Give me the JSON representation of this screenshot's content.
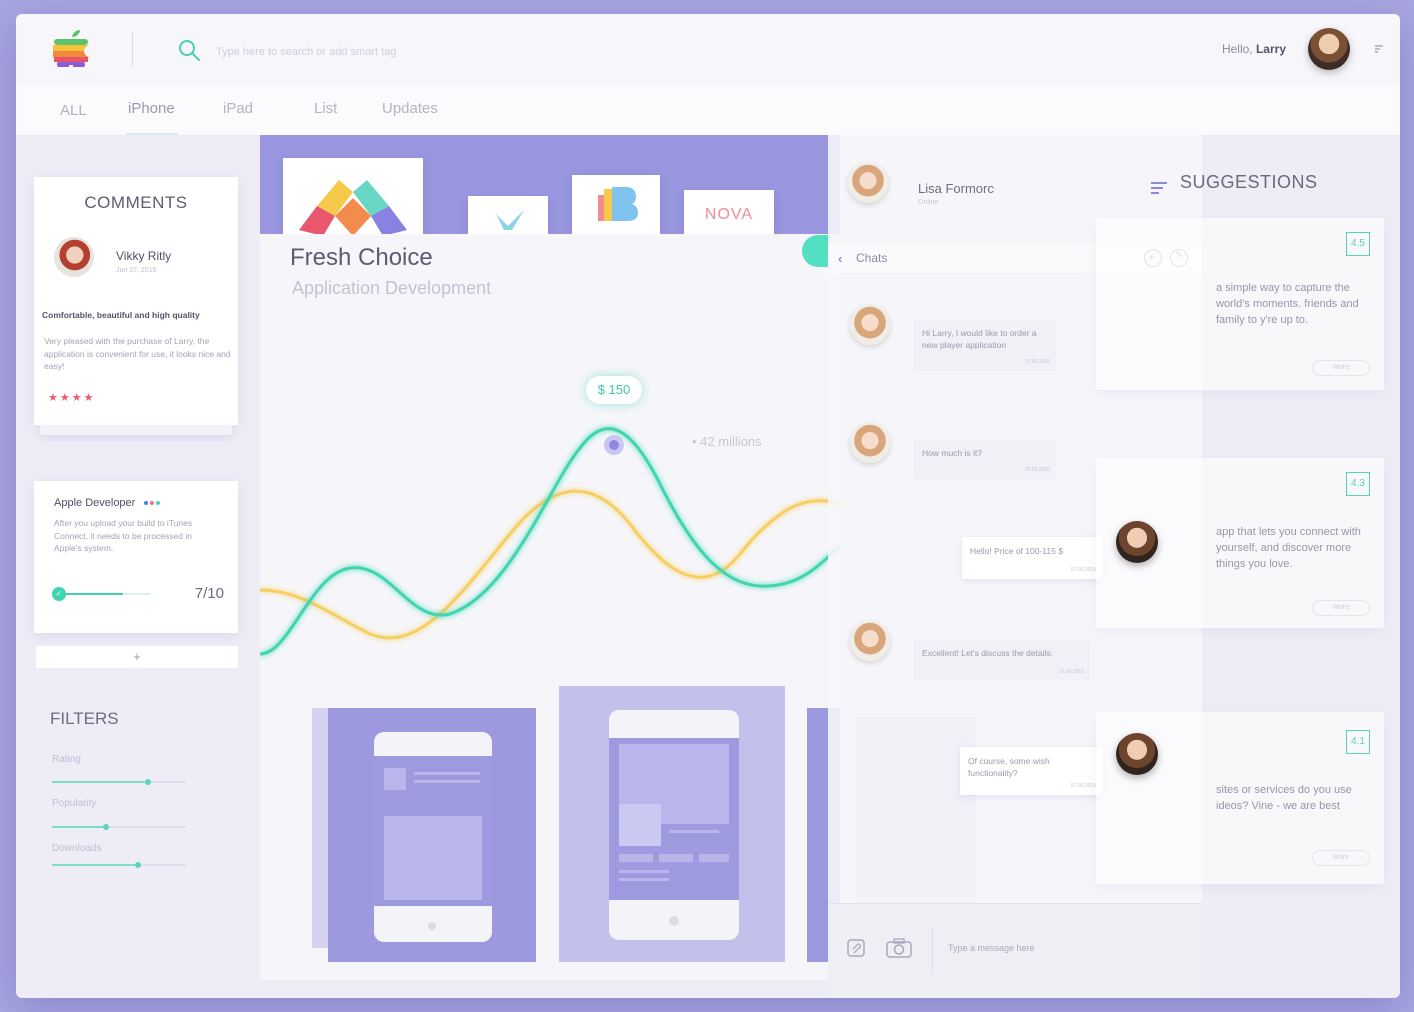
{
  "header": {
    "search_placeholder": "Type here to search or add smart tag",
    "greeting_prefix": "Hello, ",
    "greeting_name": "Larry"
  },
  "tabs": [
    {
      "label": "ALL"
    },
    {
      "label": "iPhone"
    },
    {
      "label": "iPad"
    },
    {
      "label": "List"
    },
    {
      "label": "Updates"
    }
  ],
  "comments": {
    "title": "COMMENTS",
    "author": "Vikky Ritly",
    "date": "Jun 27, 2016",
    "review_title": "Comfortable, beautiful and high quality",
    "review_body": "Very pleased with the purchase of Larry, the application is convenient for use, it looks nice and easy!",
    "stars": "★★★★"
  },
  "apple_card": {
    "title": "Apple Developer",
    "body": "After you upload your build to iTunes Connect, it needs to be processed in Apple's system.",
    "progress_value": "7/10",
    "progress_fraction": 0.7,
    "dot_colors": [
      "#4a7cf5",
      "#f56b8a",
      "#44d1b4"
    ],
    "add_label": "+"
  },
  "filters": {
    "title": "FILTERS",
    "items": [
      {
        "label": "Rating",
        "value": 0.72
      },
      {
        "label": "Popularity",
        "value": 0.4
      },
      {
        "label": "Downloads",
        "value": 0.64
      }
    ]
  },
  "app": {
    "title": "Fresh Choice",
    "subtitle": "Application Development",
    "price": "$ 150",
    "millions": "• 42 millions",
    "nova_label": "NOVA"
  },
  "chat": {
    "contact_name": "Lisa Formorc",
    "contact_status": "Online",
    "header_label": "Chats",
    "input_placeholder": "Type a message here",
    "messages": [
      {
        "text": "Hi Larry, I would like to order a new player application",
        "time": "07.06.2016"
      },
      {
        "text": "How much is it?",
        "time": "07.06.2016"
      },
      {
        "text": "Hello! Price of 100-115 $",
        "time": "07.06.2016"
      },
      {
        "text": "Excellent! Let's discuss the details.",
        "time": "07.06.2016"
      },
      {
        "text": "Of course, some wish functionality?",
        "time": "07.06.2016"
      }
    ]
  },
  "suggestions": {
    "title": "SUGGESTIONS",
    "items": [
      {
        "rating": "4.5",
        "text": "a simple way to capture the world's moments. friends and family to y're up to.",
        "more": "More"
      },
      {
        "rating": "4.3",
        "text": "app that lets you connect with yourself, and discover more things you love.",
        "more": "More"
      },
      {
        "rating": "4.1",
        "text": "sites or services do you use ideos? Vine - we are best",
        "more": "More"
      }
    ]
  }
}
